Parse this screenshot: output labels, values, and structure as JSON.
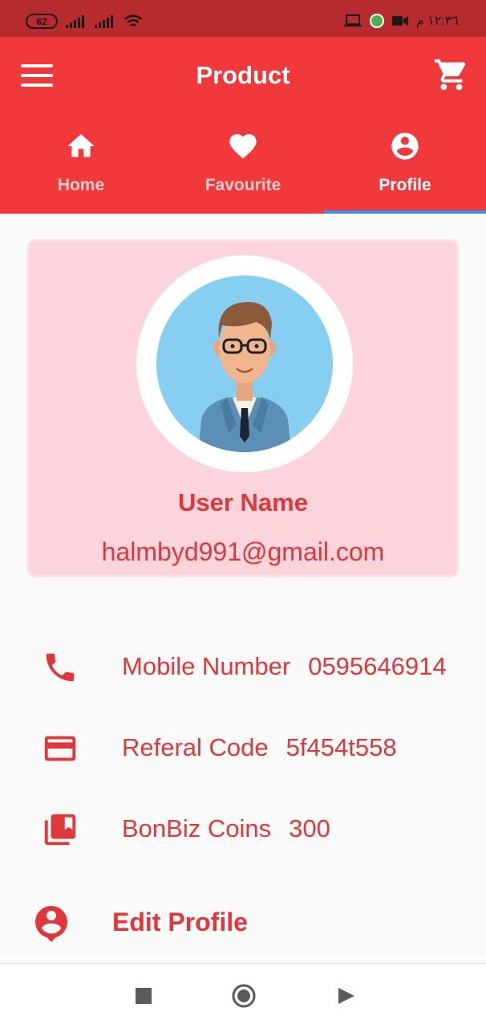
{
  "status_bar": {
    "battery": "62",
    "time": "١٢:٣٦ م"
  },
  "app_bar": {
    "title": "Product",
    "menu_icon": "hamburger-menu-icon",
    "cart_icon": "shopping-cart-icon"
  },
  "tabs": [
    {
      "label": "Home",
      "icon": "home-icon",
      "active": false
    },
    {
      "label": "Favourite",
      "icon": "heart-icon",
      "active": false
    },
    {
      "label": "Profile",
      "icon": "account-circle-icon",
      "active": true
    }
  ],
  "profile": {
    "name": "User Name",
    "email": "halmbyd991@gmail.com"
  },
  "info": [
    {
      "icon": "phone-icon",
      "label": "Mobile Number",
      "value": "0595646914"
    },
    {
      "icon": "credit-card-icon",
      "label": "Referal Code",
      "value": "5f454t558"
    },
    {
      "icon": "collections-bookmark-icon",
      "label": "BonBiz Coins",
      "value": "300"
    }
  ],
  "edit_profile": {
    "label": "Edit Profile",
    "icon": "account-pin-icon"
  },
  "colors": {
    "primary": "#f1393c",
    "status_bar": "#b72b2e",
    "accent_text": "#e0373a",
    "card_bg": "#fbd4dc",
    "tab_indicator": "#3d8ee8"
  }
}
